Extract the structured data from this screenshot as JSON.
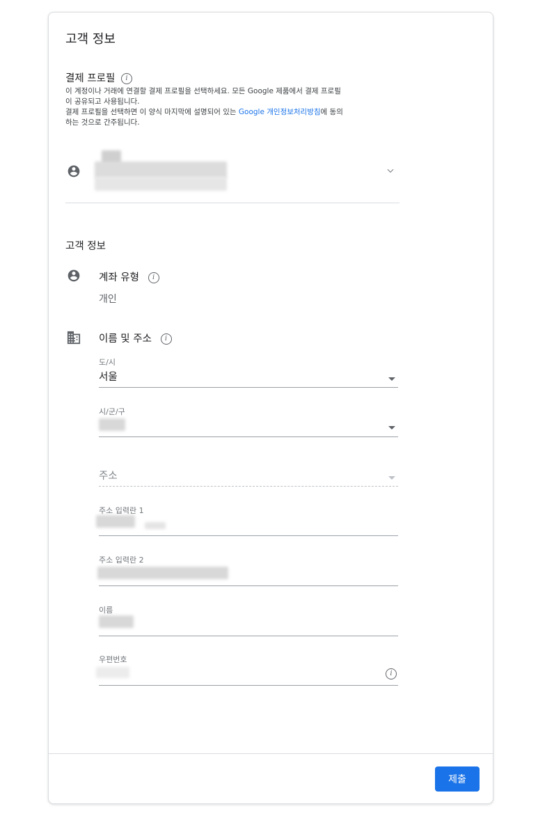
{
  "card": {
    "title": "고객 정보",
    "payment_profile": {
      "heading": "결제 프로필",
      "desc_line1": "이 계정이나 거래에 연결할 결제 프로필을 선택하세요. 모든 Google 제품에서 결제 프로필",
      "desc_line2": "이 공유되고 사용됩니다.",
      "desc_line3_before": "결제 프로필을 선택하면 이 양식 마지막에 설명되어 있는 ",
      "desc_link": "Google 개인정보처리방침",
      "desc_line3_after": "에 동의",
      "desc_line4": "하는 것으로 간주됩니다."
    },
    "customer_info": {
      "heading": "고객 정보",
      "account_type_label": "계좌 유형",
      "account_type_value": "개인",
      "name_address_label": "이름 및 주소"
    },
    "fields": {
      "city_label": "도/시",
      "city_value": "서울",
      "district_label": "시/군/구",
      "address_placeholder": "주소",
      "address1_label": "주소 입력란 1",
      "address2_label": "주소 입력란 2",
      "name_label": "이름",
      "postal_label": "우편번호"
    },
    "submit_label": "제출"
  }
}
